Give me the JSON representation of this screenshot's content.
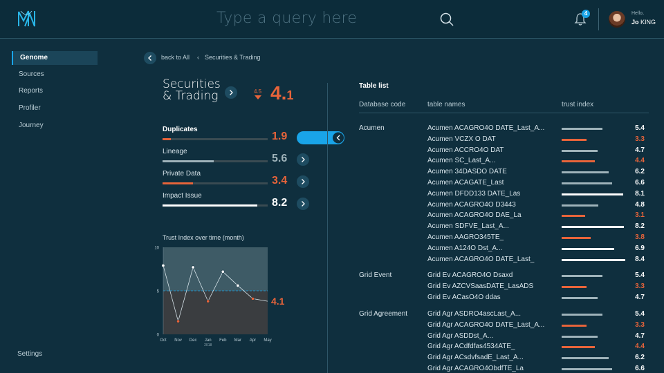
{
  "header": {
    "search_placeholder": "Type a query here",
    "notification_count": "4",
    "greeting": "Hello,",
    "user_first": "Jo",
    "user_last": "KING"
  },
  "sidebar": {
    "items": [
      {
        "label": "Genome",
        "active": true
      },
      {
        "label": "Sources",
        "active": false
      },
      {
        "label": "Reports",
        "active": false
      },
      {
        "label": "Profiler",
        "active": false
      },
      {
        "label": "Journey",
        "active": false
      }
    ],
    "settings": "Settings"
  },
  "breadcrumb": {
    "back": "back to All",
    "current": "Securities & Trading"
  },
  "overview": {
    "title_line1": "Securities",
    "title_line2": "& Trading",
    "prev_score": "4.5",
    "score_int": "4.",
    "score_dec": "1",
    "metrics": [
      {
        "label": "Duplicates",
        "value": "1.9",
        "fill": 0.08,
        "color": "#e8643a",
        "selected": true
      },
      {
        "label": "Lineage",
        "value": "5.6",
        "fill": 0.49,
        "color": "#9fb3ba",
        "selected": false
      },
      {
        "label": "Private Data",
        "value": "3.4",
        "fill": 0.29,
        "color": "#e8643a",
        "selected": false
      },
      {
        "label": "Impact Issue",
        "value": "8.2",
        "fill": 0.9,
        "color": "#ffffff",
        "selected": false
      }
    ]
  },
  "chart_data": {
    "type": "line",
    "title": "Trust Index over time (month)",
    "categories": [
      "Oct",
      "Nov",
      "Dec",
      "Jan",
      "Feb",
      "Mar",
      "Apr",
      "May"
    ],
    "year_label": "2018",
    "values": [
      7.9,
      1.5,
      7.7,
      3.8,
      7.2,
      5.6,
      4.1,
      3.8
    ],
    "threshold": 5,
    "ylim": [
      0,
      10
    ],
    "yticks": [
      "0",
      "5",
      "10"
    ],
    "end_label": "4.1"
  },
  "table": {
    "title": "Table list",
    "col_code": "Database code",
    "col_names": "table names",
    "col_trust": "trust index",
    "groups": [
      {
        "code": "Acumen",
        "rows": [
          {
            "name": "Acumen ACAGRO4O DATE_Last_A...",
            "value": "5.4"
          },
          {
            "name": "Acumen VCZX O DAT",
            "value": "3.3"
          },
          {
            "name": "Acumen ACCRO4O DAT",
            "value": "4.7"
          },
          {
            "name": "Acumen SC_Last_A...",
            "value": "4.4"
          },
          {
            "name": "Acumen 34DASDO DATE",
            "value": "6.2"
          },
          {
            "name": "Acumen ACAGATE_Last",
            "value": "6.6"
          },
          {
            "name": "Acumen DFDD133 DATE_Las",
            "value": "8.1"
          },
          {
            "name": "Acumen ACAGRO4O D3443",
            "value": "4.8"
          },
          {
            "name": "Acumen ACAGRO4O DAE_La",
            "value": "3.1"
          },
          {
            "name": "Acumen  SDFVE_Last_A...",
            "value": "8.2"
          },
          {
            "name": "Acumen AAGRO345TE_",
            "value": "3.8"
          },
          {
            "name": "Acumen A124O Dst_A...",
            "value": "6.9"
          },
          {
            "name": "Acumen ACAGRO4O DATE_Last_",
            "value": "8.4"
          }
        ]
      },
      {
        "code": "Grid Event",
        "rows": [
          {
            "name": "Grid Ev ACAGRO4O Dsaxd",
            "value": "5.4"
          },
          {
            "name": "Grid Ev AZCVSaasDATE_LasADS",
            "value": "3.3"
          },
          {
            "name": "Grid Ev ACasO4O ddas",
            "value": "4.7"
          }
        ]
      },
      {
        "code": "Grid Agreement",
        "rows": [
          {
            "name": "Grid Agr ASDRO4ascLast_A...",
            "value": "5.4"
          },
          {
            "name": "Grid Agr ACAGRO4O DATE_Last_A...",
            "value": "3.3"
          },
          {
            "name": "Grid Agr ASDDst_A...",
            "value": "4.7"
          },
          {
            "name": "Grid Agr ACdfdfas4534ATE_",
            "value": "4.4"
          },
          {
            "name": "Grid Agr ACsdvfsadE_Last_A...",
            "value": "6.2"
          },
          {
            "name": "Grid Agr ACAGRO4ObdfTE_La",
            "value": "6.6"
          }
        ]
      }
    ]
  },
  "colors": {
    "accent": "#19a4e8",
    "warn": "#e8643a",
    "good": "#ffffff",
    "neutral": "#9fb3ba"
  }
}
